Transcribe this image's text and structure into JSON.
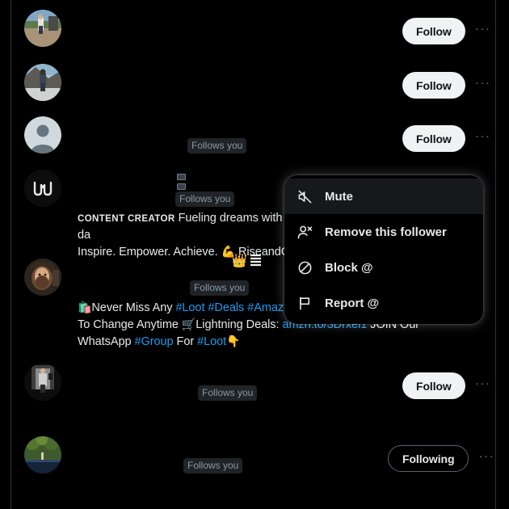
{
  "screen": {
    "name": "followers-list-with-context-menu",
    "background": "#000000",
    "accent_link_color": "#1d9bf0",
    "border_color": "#2f3336"
  },
  "follows_you_label": "Follows you",
  "more_glyph": "···",
  "rows": [
    {
      "id": "row-1",
      "avatar": "photo-beach-person",
      "follows_you": false,
      "button": {
        "label": "Follow",
        "style": "follow"
      }
    },
    {
      "id": "row-2",
      "avatar": "photo-outdoor-rock",
      "follows_you": false,
      "button": {
        "label": "Follow",
        "style": "follow"
      }
    },
    {
      "id": "row-3",
      "avatar": "default-person-placeholder",
      "follows_you": true,
      "button": {
        "label": "Follow",
        "style": "follow"
      }
    },
    {
      "id": "row-4",
      "avatar": "logo-m-mark",
      "follows_you": true,
      "button": null
    },
    {
      "id": "row-5",
      "avatar": "photo-bearded-man",
      "follows_you": true,
      "button": null
    },
    {
      "id": "row-6",
      "avatar": "photo-mirror-selfie",
      "follows_you": true,
      "button": {
        "label": "Follow",
        "style": "follow"
      }
    },
    {
      "id": "row-7",
      "avatar": "photo-nature-river",
      "follows_you": true,
      "button": {
        "label": "Following",
        "style": "following"
      }
    }
  ],
  "bio_creator": {
    "badge": "Content creator",
    "line1": "Fueling dreams with da",
    "line2_a": "Inspire. Empower. Achieve. ",
    "line2_emoji": "💪",
    "line2_b": " RiseandG"
  },
  "bio_deals": {
    "emoji_bags": "🛍️",
    "text1": "Never Miss Any ",
    "tag1": "#Loot",
    "sep1": " ",
    "tag2": "#Deals",
    "sep2": " ",
    "tag3": "#Amaz",
    "line2_a": "To Change Anytime ",
    "cart_emoji": "🛒",
    "line2_b": "Lightning Deals: ",
    "link": "amzn.to/3Drxel1",
    "line2_c": " JOIN Our",
    "line3_a": "WhatsApp ",
    "tag4": "#Group",
    "line3_b": " For ",
    "tag5": "#Loot",
    "line3_emoji": "👇",
    "crown_emoji": "👑"
  },
  "context_menu": {
    "name": "follower-options-menu",
    "items": [
      {
        "id": "mute",
        "label": "Mute",
        "icon": "mute-icon",
        "highlighted": true
      },
      {
        "id": "remove-follower",
        "label": "Remove this follower",
        "icon": "person-remove-icon",
        "highlighted": false
      },
      {
        "id": "block",
        "label": "Block @",
        "icon": "block-icon",
        "highlighted": false
      },
      {
        "id": "report",
        "label": "Report @",
        "icon": "flag-icon",
        "highlighted": false
      }
    ]
  }
}
